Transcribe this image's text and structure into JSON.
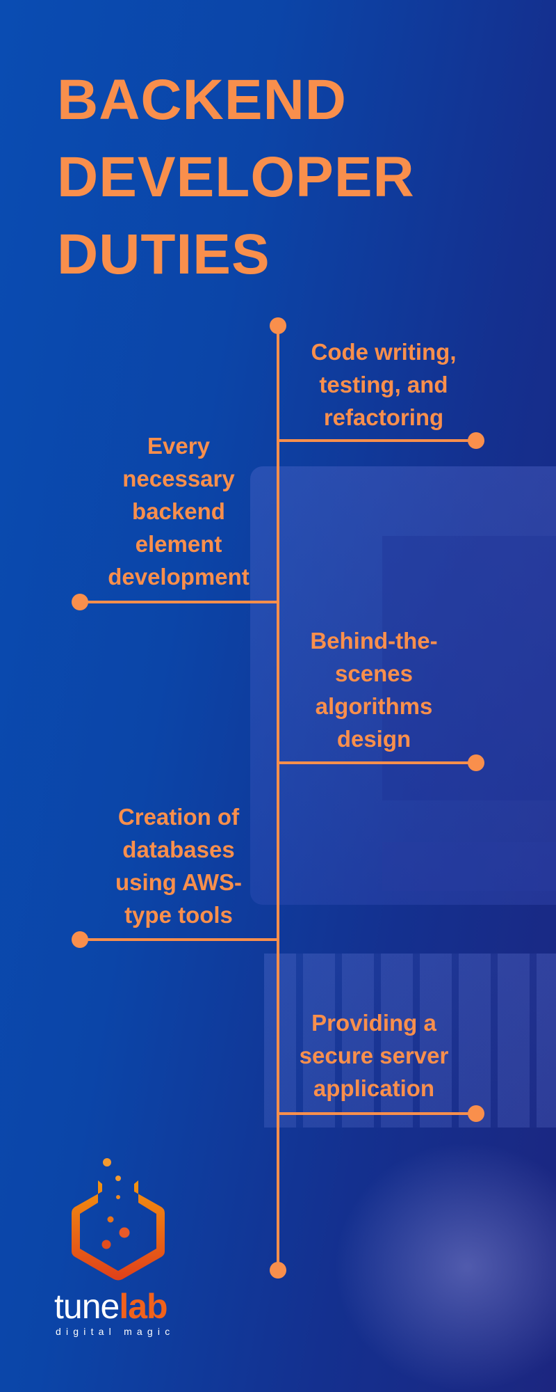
{
  "title": {
    "lines": [
      "BACKEND",
      "DEVELOPER",
      "DUTIES"
    ]
  },
  "duties": [
    {
      "lines": [
        "Code writing,",
        "testing, and",
        "refactoring"
      ],
      "side": "right"
    },
    {
      "lines": [
        "Every",
        "necessary",
        "backend",
        "element",
        "development"
      ],
      "side": "left"
    },
    {
      "lines": [
        "Behind-the-",
        "scenes",
        "algorithms",
        "design"
      ],
      "side": "right"
    },
    {
      "lines": [
        "Creation of",
        "databases",
        "using AWS-",
        "type tools"
      ],
      "side": "left"
    },
    {
      "lines": [
        "Providing a",
        "secure server",
        "application"
      ],
      "side": "right"
    }
  ],
  "brand": {
    "name_part1": "tune",
    "name_part2": "lab",
    "tagline": "digital magic"
  },
  "colors": {
    "accent": "#f98f4c",
    "background": "#0b45a8",
    "logo_orange": "#f0621c"
  }
}
